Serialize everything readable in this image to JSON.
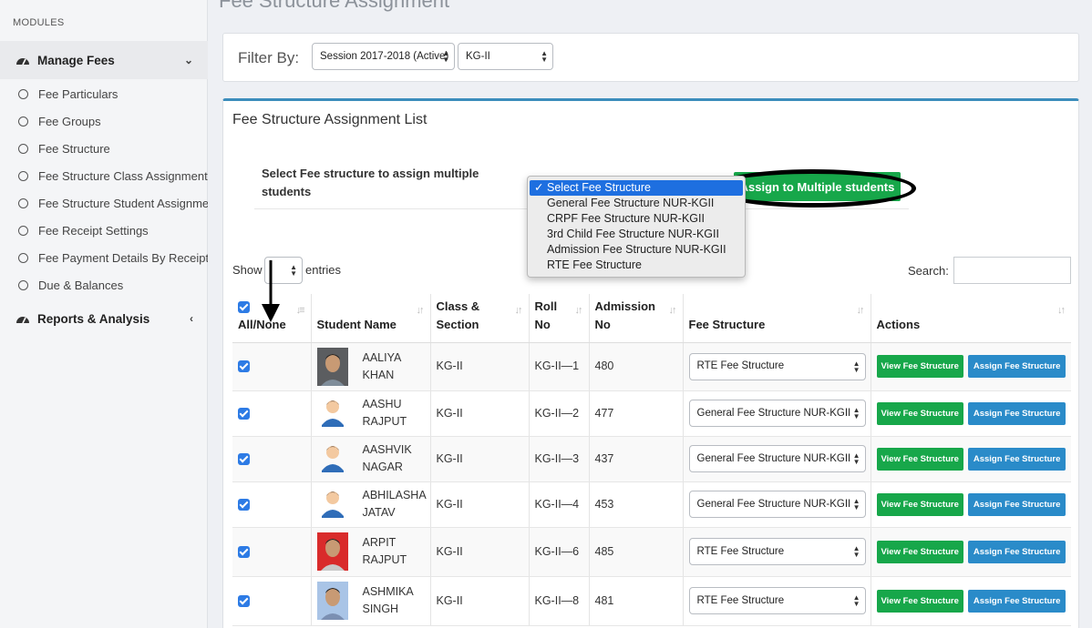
{
  "sidebar": {
    "modules_label": "MODULES",
    "manage_fees": "Manage Fees",
    "items": [
      {
        "label": "Fee Particulars"
      },
      {
        "label": "Fee Groups"
      },
      {
        "label": "Fee Structure"
      },
      {
        "label": "Fee Structure Class Assignment"
      },
      {
        "label": "Fee Structure Student Assignment"
      },
      {
        "label": "Fee Receipt Settings"
      },
      {
        "label": "Fee Payment Details By Receipt No"
      },
      {
        "label": "Due & Balances"
      }
    ],
    "reports": "Reports & Analysis"
  },
  "page_title": "Fee Structure Assignment",
  "filter": {
    "label": "Filter By:",
    "session": "Session 2017-2018 (Active)",
    "class": "KG-II"
  },
  "list": {
    "title": "Fee Structure Assignment List",
    "assign_label": "Select Fee structure to assign multiple students",
    "assign_button": "Assign to Multiple students",
    "dropdown_options": [
      "Select Fee Structure",
      "General Fee Structure NUR-KGII",
      "CRPF Fee Structure NUR-KGII",
      "3rd Child Fee Structure NUR-KGII",
      "Admission Fee Structure NUR-KGII",
      "RTE Fee Structure"
    ],
    "dropdown_check": "✓",
    "show": "Show",
    "entries": "entries",
    "search": "Search:"
  },
  "table": {
    "headers": {
      "all_none": "All/None",
      "student_name": "Student Name",
      "class_section_1": "Class &",
      "class_section_2": "Section",
      "roll_1": "Roll",
      "roll_2": "No",
      "admission_1": "Admission",
      "admission_2": "No",
      "fee_structure": "Fee Structure",
      "actions": "Actions"
    },
    "view_button": "View Fee Structure",
    "assign_button": "Assign Fee Structure",
    "rows": [
      {
        "first": "AALIYA",
        "last": "KHAN",
        "class": "KG-II",
        "roll": "KG-II—1",
        "admission": "480",
        "fee": "RTE Fee Structure",
        "photo": "photo"
      },
      {
        "first": "AASHU",
        "last": "RAJPUT",
        "class": "KG-II",
        "roll": "KG-II—2",
        "admission": "477",
        "fee": "General Fee Structure NUR-KGII",
        "photo": "avatar"
      },
      {
        "first": "AASHVIK",
        "last": "NAGAR",
        "class": "KG-II",
        "roll": "KG-II—3",
        "admission": "437",
        "fee": "General Fee Structure NUR-KGII",
        "photo": "avatar"
      },
      {
        "first": "ABHILASHA",
        "last": "JATAV",
        "class": "KG-II",
        "roll": "KG-II—4",
        "admission": "453",
        "fee": "General Fee Structure NUR-KGII",
        "photo": "avatar"
      },
      {
        "first": "ARPIT",
        "last": "RAJPUT",
        "class": "KG-II",
        "roll": "KG-II—6",
        "admission": "485",
        "fee": "RTE Fee Structure",
        "photo": "photo-red"
      },
      {
        "first": "ASHMIKA",
        "last": "SINGH",
        "class": "KG-II",
        "roll": "KG-II—8",
        "admission": "481",
        "fee": "RTE Fee Structure",
        "photo": "photo-blue"
      }
    ]
  }
}
